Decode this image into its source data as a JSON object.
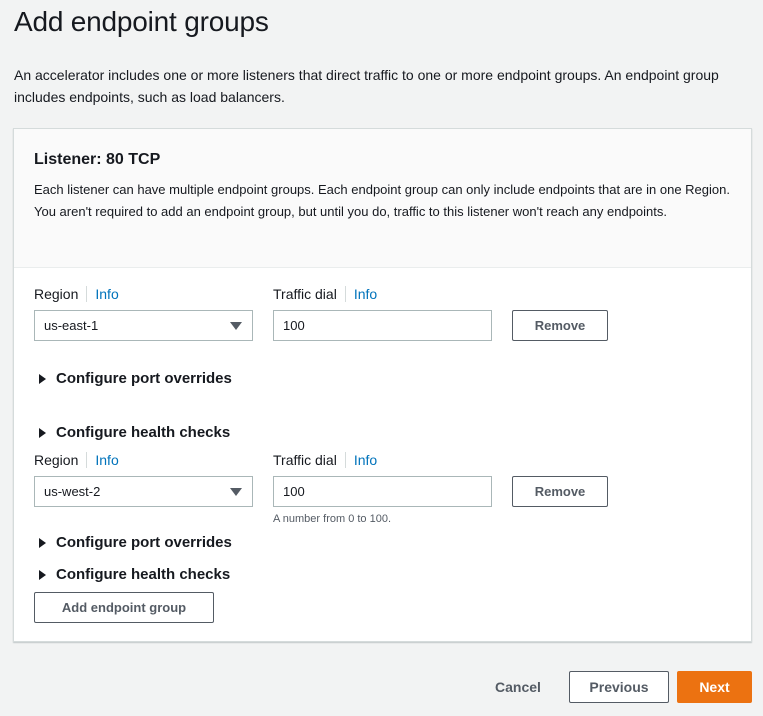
{
  "page": {
    "title": "Add endpoint groups",
    "description": "An accelerator includes one or more listeners that direct traffic to one or more endpoint groups. An endpoint group includes endpoints, such as load balancers."
  },
  "listener": {
    "title": "Listener: 80 TCP",
    "description": "Each listener can have multiple endpoint groups. Each endpoint group can only include endpoints that are in one Region. You aren't required to add an endpoint group, but until you do, traffic to this listener won't reach any endpoints."
  },
  "groups": [
    {
      "region_label": "Region",
      "region_info": "Info",
      "region_value": "us-east-1",
      "dial_label": "Traffic dial",
      "dial_info": "Info",
      "dial_value": "100",
      "remove_label": "Remove",
      "port_overrides": "Configure port overrides",
      "health_checks": "Configure health checks"
    },
    {
      "region_label": "Region",
      "region_info": "Info",
      "region_value": "us-west-2",
      "dial_label": "Traffic dial",
      "dial_info": "Info",
      "dial_value": "100",
      "dial_hint": "A number from 0 to 100.",
      "remove_label": "Remove",
      "port_overrides": "Configure port overrides",
      "health_checks": "Configure health checks"
    }
  ],
  "add_group_label": "Add endpoint group",
  "footer": {
    "cancel": "Cancel",
    "previous": "Previous",
    "next": "Next"
  },
  "colors": {
    "primary": "#ec7211",
    "link": "#0073bb"
  },
  "icons": {
    "caret": "caret-down-icon",
    "expand": "triangle-right-icon"
  }
}
